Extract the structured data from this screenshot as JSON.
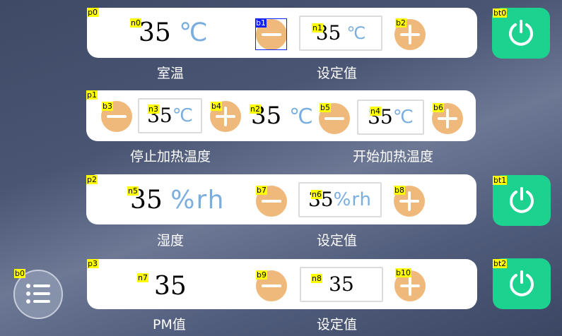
{
  "colors": {
    "accent_green": "#1cd28f",
    "button_orange": "#f0b97c",
    "unit_blue": "#7aaedf"
  },
  "tags": {
    "p0": "p0",
    "p1": "p1",
    "p2": "p2",
    "p3": "p3",
    "n0": "n0",
    "n1": "n1",
    "n2": "n2",
    "n3": "n3",
    "n4": "n4",
    "n5": "n5",
    "n6": "n6",
    "n7": "n7",
    "n8": "n8",
    "b0": "b0",
    "b1": "b1",
    "b2": "b2",
    "b3": "b3",
    "b4": "b4",
    "b5": "b5",
    "b6": "b6",
    "b7": "b7",
    "b8": "b8",
    "b9": "b9",
    "b10": "b10",
    "bt0": "bt0",
    "bt1": "bt1",
    "bt2": "bt2"
  },
  "room_temp": {
    "value": "35",
    "unit": "℃",
    "label": "室温",
    "setpoint": "35",
    "setpoint_unit": "℃",
    "setpoint_label": "设定值"
  },
  "heat_range": {
    "stop_value": "35",
    "stop_unit": "℃",
    "stop_label": "停止加热温度",
    "current": "35",
    "current_unit": "℃",
    "start_value": "35",
    "start_unit": "℃",
    "start_label": "开始加热温度"
  },
  "humidity": {
    "value": "35",
    "unit": "%rh",
    "label": "湿度",
    "setpoint": "35",
    "setpoint_unit": "%rh",
    "setpoint_label": "设定值"
  },
  "pm": {
    "value": "35",
    "label": "PM值",
    "setpoint": "35",
    "setpoint_label": "设定值"
  },
  "icons": {
    "minus": "minus-icon",
    "plus": "plus-icon",
    "power": "power-icon",
    "menu": "list-menu-icon"
  }
}
